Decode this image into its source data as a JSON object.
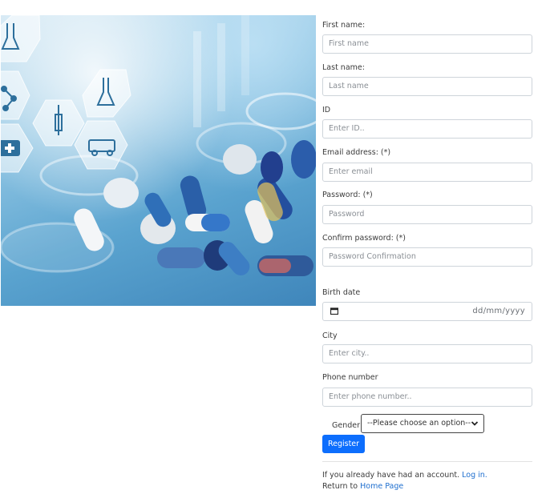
{
  "hero": {
    "icons": [
      "flask-icon",
      "molecule-icon",
      "syringe-icon",
      "beaker-icon",
      "medical-kit-icon",
      "ambulance-icon"
    ]
  },
  "form": {
    "first_name": {
      "label": "First name:",
      "placeholder": "First name"
    },
    "last_name": {
      "label": "Last name:",
      "placeholder": "Last name"
    },
    "id": {
      "label": "ID",
      "placeholder": "Enter ID.."
    },
    "email": {
      "label": "Email address: (*)",
      "placeholder": "Enter email"
    },
    "password": {
      "label": "Password: (*)",
      "placeholder": "Password"
    },
    "confirm_password": {
      "label": "Confirm password: (*)",
      "placeholder": "Password Confirmation"
    },
    "birth_date": {
      "label": "Birth date",
      "placeholder": "dd/mm/yyyy"
    },
    "city": {
      "label": "City",
      "placeholder": "Enter city.."
    },
    "phone": {
      "label": "Phone number",
      "placeholder": "Enter phone number.."
    },
    "gender": {
      "label": "Gender",
      "selected": "--Please choose an option--"
    },
    "register_label": "Register"
  },
  "footer": {
    "account_text": "If you already have had an account.",
    "login_link": "Log in.",
    "return_text": "Return to",
    "home_link": "Home Page"
  },
  "colors": {
    "primary": "#0d6efd",
    "link": "#1f6fcf",
    "border": "#ced4da"
  }
}
